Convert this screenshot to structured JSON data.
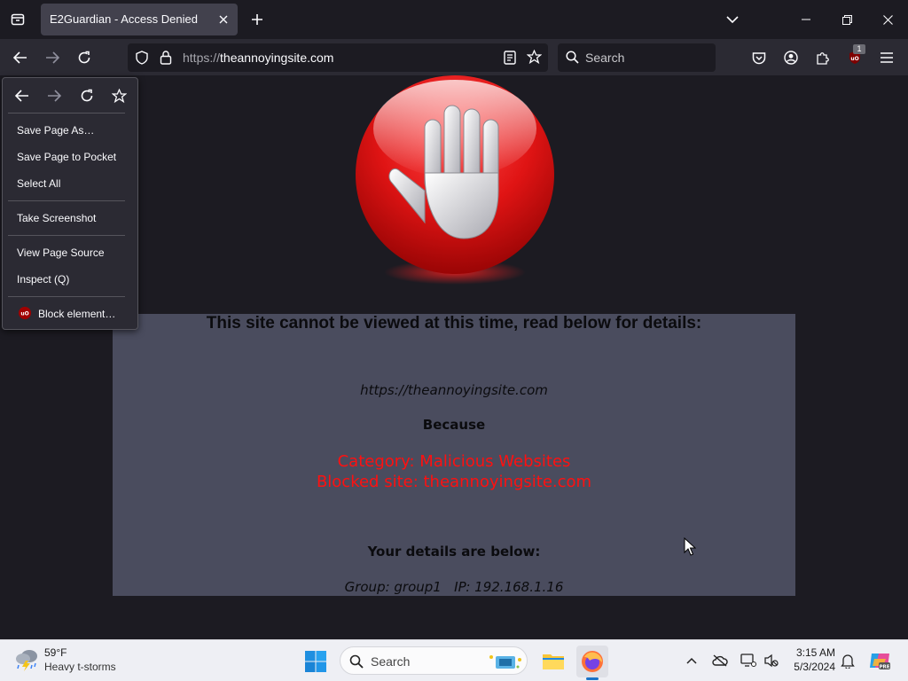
{
  "browser": {
    "tab": {
      "title": "E2Guardian - Access Denied"
    },
    "url": {
      "scheme": "https://",
      "host": "theannoyingsite.com"
    },
    "search": {
      "placeholder": "Search"
    },
    "extension_badge": "1"
  },
  "context_menu": {
    "items": [
      {
        "label": "Save Page As…"
      },
      {
        "label": "Save Page to Pocket"
      },
      {
        "label": "Select All"
      },
      {
        "label": "Take Screenshot"
      },
      {
        "label": "View Page Source"
      },
      {
        "label": "Inspect (Q)"
      },
      {
        "label": "Block element…"
      }
    ]
  },
  "block_page": {
    "heading": "This site cannot be viewed at this time, read below for details:",
    "blocked_url": "https://theannoyingsite.com",
    "because": "Because",
    "category": "Category: Malicious Websites",
    "blocked_site": "Blocked site: theannoyingsite.com",
    "details_heading": "Your details are below:",
    "group_ip": "Group: group1   IP: 192.168.1.16"
  },
  "taskbar": {
    "weather": {
      "temp": "59°F",
      "desc": "Heavy t-storms"
    },
    "search": {
      "placeholder": "Search"
    },
    "clock": {
      "time": "3:15 AM",
      "date": "5/3/2024"
    }
  },
  "colors": {
    "chrome_bg": "#1c1b22",
    "toolbar_bg": "#2b2a33",
    "panel_bg": "#4a4c5e",
    "alert_red": "#ff1010",
    "taskbar_bg": "#eeeff4"
  }
}
